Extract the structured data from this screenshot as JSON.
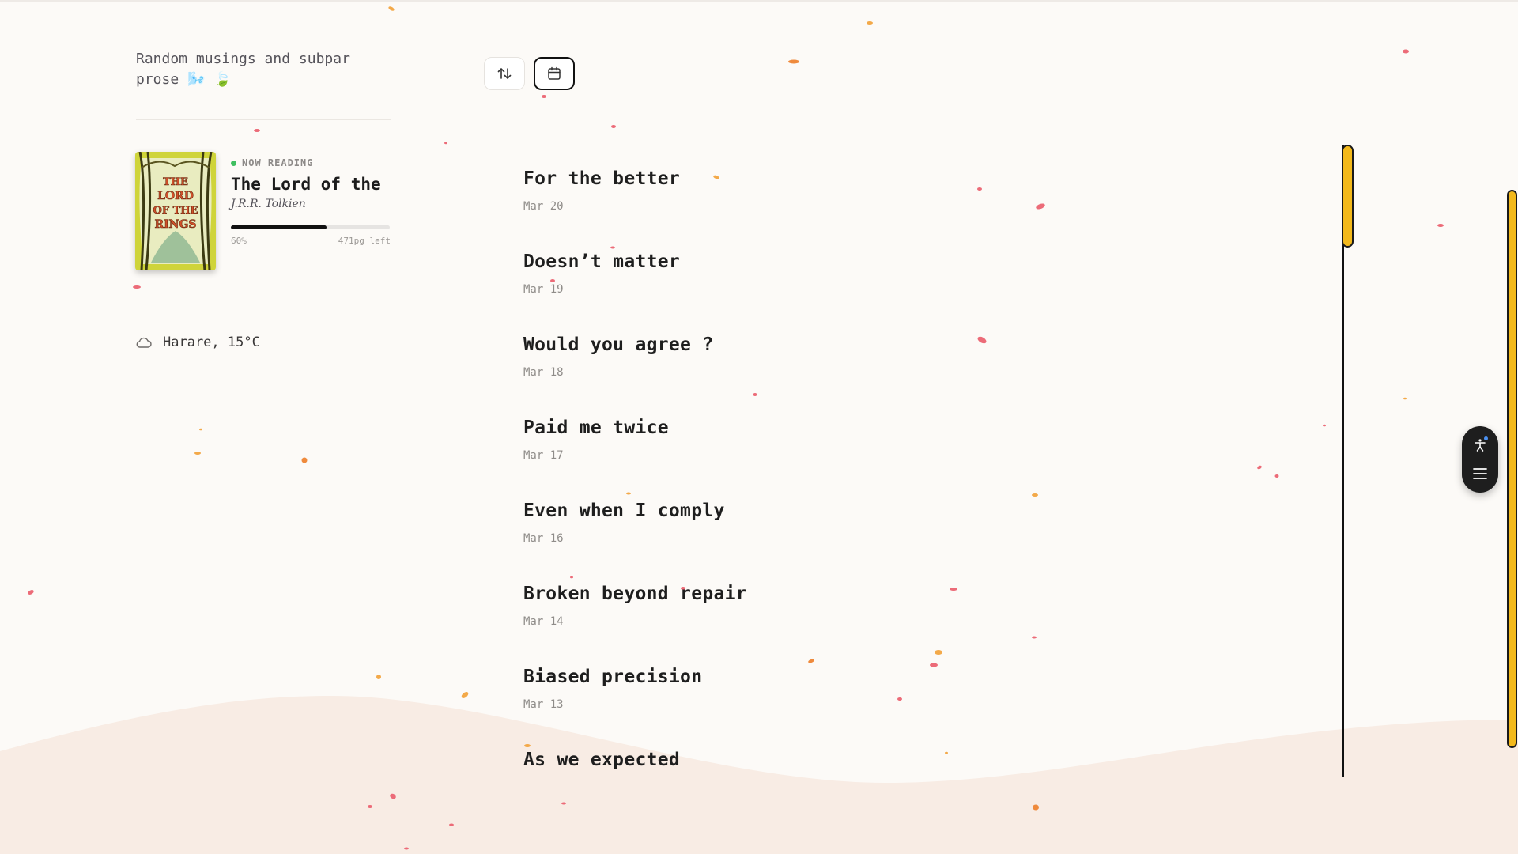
{
  "sidebar": {
    "tagline": "Random musings and subpar prose 🌬️ 🍃",
    "now_reading": {
      "label": "NOW READING",
      "title": "The Lord of the Rings",
      "author": "J.R.R. Tolkien",
      "cover_text": "THE LORD OF THE RINGS",
      "progress": 0.6,
      "progress_label": "60%",
      "pages_left": "471pg left"
    },
    "weather": {
      "icon": "cloud-icon",
      "text": "Harare, 15°C"
    }
  },
  "toolbar": {
    "sort_icon": "sort-arrows-icon",
    "calendar_icon": "calendar-icon"
  },
  "posts": [
    {
      "title": "For the better",
      "date": "Mar 20"
    },
    {
      "title": "Doesn’t matter",
      "date": "Mar 19"
    },
    {
      "title": "Would you agree ?",
      "date": "Mar 18"
    },
    {
      "title": "Paid me twice",
      "date": "Mar 17"
    },
    {
      "title": "Even when I comply",
      "date": "Mar 16"
    },
    {
      "title": "Broken beyond repair",
      "date": "Mar 14"
    },
    {
      "title": "Biased precision",
      "date": "Mar 13"
    },
    {
      "title": "As we expected",
      "date": ""
    }
  ],
  "floating_widget": {
    "icons": [
      "accessibility-icon",
      "menu-icon"
    ]
  },
  "colors": {
    "background": "#fcfaf7",
    "accent": "#f3b91b",
    "wave": "#f8ece4",
    "reading_dot": "#3fbf60"
  }
}
